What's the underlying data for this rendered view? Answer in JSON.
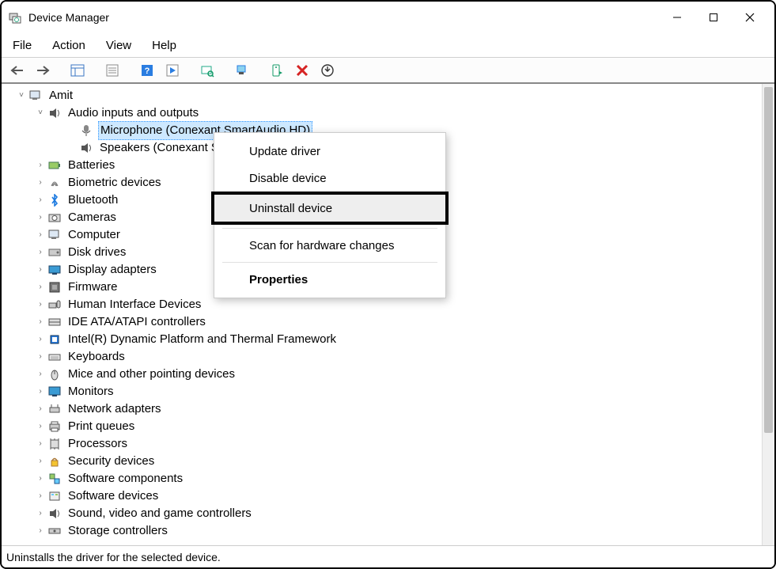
{
  "window": {
    "title": "Device Manager"
  },
  "menubar": {
    "file": "File",
    "action": "Action",
    "view": "View",
    "help": "Help"
  },
  "tree": {
    "root": "Amit",
    "audio_inputs_outputs": "Audio inputs and outputs",
    "microphone": "Microphone (Conexant SmartAudio HD)",
    "speakers": "Speakers (Conexant SmartAudio HD)",
    "batteries": "Batteries",
    "biometric": "Biometric devices",
    "bluetooth": "Bluetooth",
    "cameras": "Cameras",
    "computer": "Computer",
    "disk_drives": "Disk drives",
    "display_adapters": "Display adapters",
    "firmware": "Firmware",
    "hid": "Human Interface Devices",
    "ide": "IDE ATA/ATAPI controllers",
    "intel_dynamic": "Intel(R) Dynamic Platform and Thermal Framework",
    "keyboards": "Keyboards",
    "mice": "Mice and other pointing devices",
    "monitors": "Monitors",
    "network": "Network adapters",
    "print_queues": "Print queues",
    "processors": "Processors",
    "security": "Security devices",
    "software_components": "Software components",
    "software_devices": "Software devices",
    "sound_video": "Sound, video and game controllers",
    "storage": "Storage controllers"
  },
  "contextmenu": {
    "update_driver": "Update driver",
    "disable_device": "Disable device",
    "uninstall_device": "Uninstall device",
    "scan_hardware": "Scan for hardware changes",
    "properties": "Properties"
  },
  "statusbar": {
    "text": "Uninstalls the driver for the selected device."
  }
}
